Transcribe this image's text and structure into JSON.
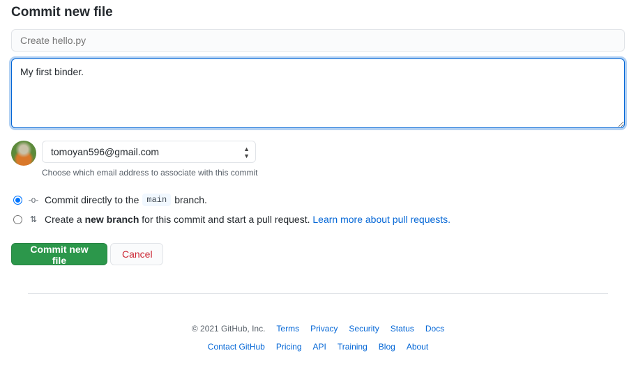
{
  "title": "Commit new file",
  "summary": {
    "placeholder": "Create hello.py"
  },
  "description": {
    "value": "My first binder."
  },
  "email": {
    "selected": "tomoyan596@gmail.com",
    "hint": "Choose which email address to associate with this commit"
  },
  "options": {
    "direct": {
      "pre": "Commit directly to the",
      "branch": "main",
      "post": "branch.",
      "checked": true
    },
    "newbranch": {
      "pre": "Create a",
      "bold": "new branch",
      "post": "for this commit and start a pull request.",
      "link": "Learn more about pull requests.",
      "checked": false
    }
  },
  "buttons": {
    "commit": "Commit new file",
    "cancel": "Cancel"
  },
  "footer": {
    "copyright": "© 2021 GitHub, Inc.",
    "row1": [
      "Terms",
      "Privacy",
      "Security",
      "Status",
      "Docs"
    ],
    "row2": [
      "Contact GitHub",
      "Pricing",
      "API",
      "Training",
      "Blog",
      "About"
    ]
  },
  "colors": {
    "primary": "#2c974b",
    "link": "#0366d6",
    "danger": "#cb2431"
  }
}
